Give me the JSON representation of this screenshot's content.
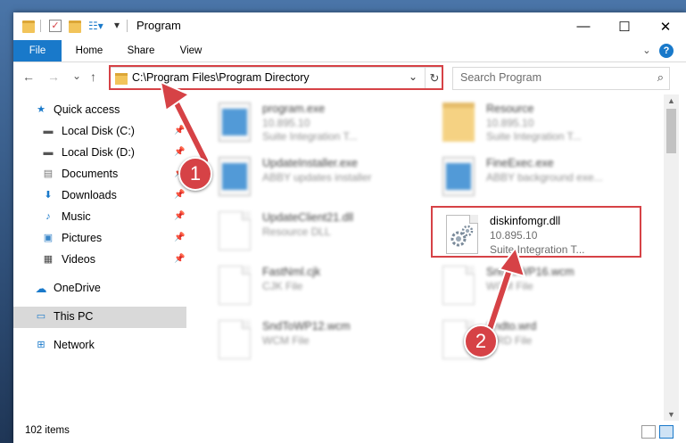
{
  "window": {
    "title": "Program",
    "buttons": {
      "minimize": "—",
      "maximize": "☐",
      "close": "✕"
    }
  },
  "ribbon": {
    "tabs": [
      "File",
      "Home",
      "Share",
      "View"
    ],
    "expand": "⌄",
    "help": "?"
  },
  "nav": {
    "back": "←",
    "forward": "→",
    "recent": "⌄",
    "up": "↑",
    "address": "C:\\Program Files\\Program Directory",
    "address_dropdown": "⌄",
    "refresh": "↻",
    "search_placeholder": "Search Program",
    "search_icon": "⌕"
  },
  "sidebar": {
    "items": [
      {
        "label": "Quick access",
        "icon": "star-icon",
        "pinned": false
      },
      {
        "label": "Local Disk (C:)",
        "icon": "drive-icon",
        "pinned": true
      },
      {
        "label": "Local Disk (D:)",
        "icon": "drive-icon",
        "pinned": true
      },
      {
        "label": "Documents",
        "icon": "documents-icon",
        "pinned": true
      },
      {
        "label": "Downloads",
        "icon": "download-icon",
        "pinned": true
      },
      {
        "label": "Music",
        "icon": "music-icon",
        "pinned": true
      },
      {
        "label": "Pictures",
        "icon": "pictures-icon",
        "pinned": true
      },
      {
        "label": "Videos",
        "icon": "videos-icon",
        "pinned": true
      },
      {
        "label": "OneDrive",
        "icon": "cloud-icon",
        "pinned": false
      },
      {
        "label": "This PC",
        "icon": "monitor-icon",
        "pinned": false,
        "selected": true
      },
      {
        "label": "Network",
        "icon": "network-icon",
        "pinned": false
      }
    ],
    "pin_glyph": "📌"
  },
  "files": [
    {
      "name": "program.exe",
      "line2": "10.895.10",
      "line3": "Suite Integration T...",
      "icon": "exe-icon",
      "blurred": true
    },
    {
      "name": "Resource",
      "line2": "10.895.10",
      "line3": "Suite Integration T...",
      "icon": "folder-icon",
      "blurred": true
    },
    {
      "name": "UpdateInstaller.exe",
      "line2": "ABBY updates installer",
      "line3": "",
      "icon": "app-window-icon",
      "blurred": true
    },
    {
      "name": "FineExec.exe",
      "line2": "ABBY background exe...",
      "line3": "",
      "icon": "app-window-icon",
      "blurred": true
    },
    {
      "name": "UpdateClient21.dll",
      "line2": "Resource DLL",
      "line3": "",
      "icon": "document-icon",
      "blurred": true
    },
    {
      "name": "diskinfomgr.dll",
      "line2": "10.895.10",
      "line3": "Suite Integration T...",
      "icon": "dll-gear-icon",
      "blurred": false
    },
    {
      "name": "FastNml.cjk",
      "line2": "CJK File",
      "line3": "",
      "icon": "document-icon",
      "blurred": true
    },
    {
      "name": "SndToWP16.wcm",
      "line2": "WCM File",
      "line3": "",
      "icon": "document-icon",
      "blurred": true
    },
    {
      "name": "SndToWP12.wcm",
      "line2": "WCM File",
      "line3": "",
      "icon": "document-icon",
      "blurred": true
    },
    {
      "name": "Sndto.wrd",
      "line2": "WRD File",
      "line3": "",
      "icon": "document-icon",
      "blurred": true
    }
  ],
  "status": {
    "count": "102 items"
  },
  "callouts": {
    "first": "1",
    "second": "2"
  },
  "colors": {
    "accent": "#1979ca",
    "highlight": "#d64246",
    "selected_bg": "#d9d9d9"
  }
}
